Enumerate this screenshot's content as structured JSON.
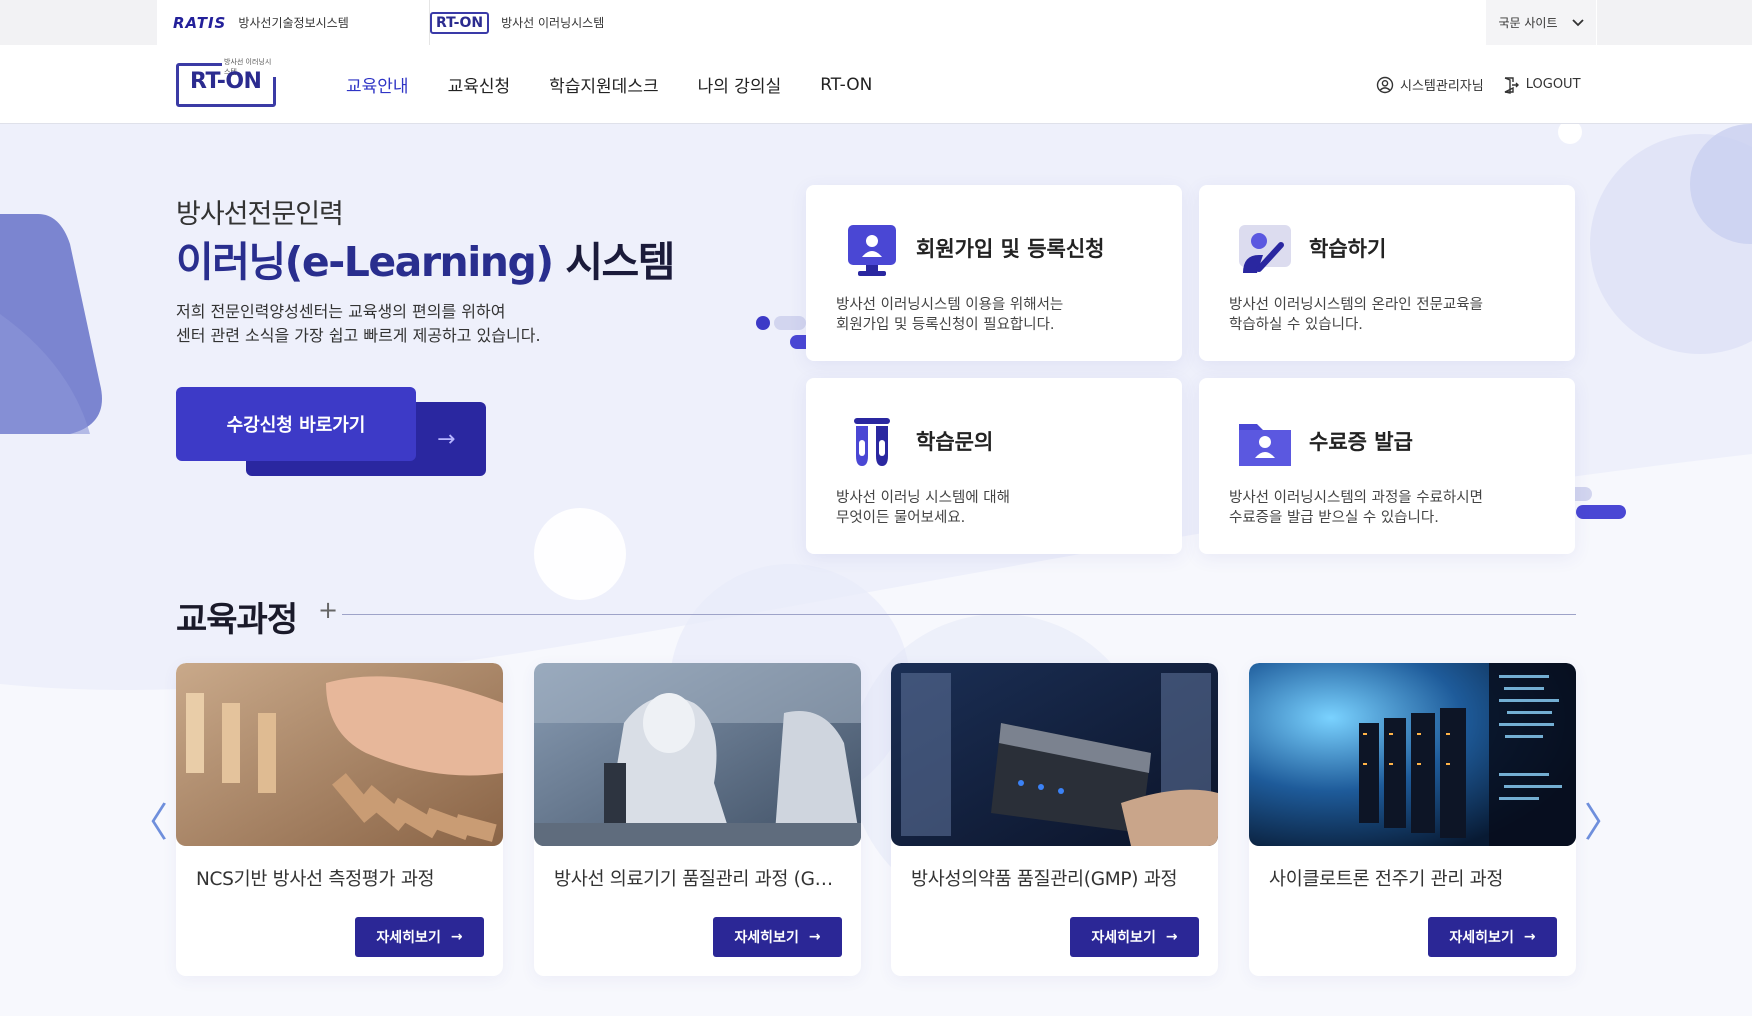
{
  "topbar": {
    "site1_logo": "RATIS",
    "site1_label": "방사선기술정보시스템",
    "site2_logo": "RT-ON",
    "site2_label": "방사선 이러닝시스템",
    "lang_label": "국문 사이트"
  },
  "header": {
    "brand_text": "RT-ON",
    "brand_sub": "방사선 이러닝시스템",
    "nav": [
      "교육안내",
      "교육신청",
      "학습지원데스크",
      "나의 강의실",
      "RT-ON"
    ],
    "user_label": "시스템관리자님",
    "logout_label": "LOGOUT"
  },
  "hero": {
    "title_line1": "방사선전문인력",
    "title_line2_accent": "이러닝(e-Learning)",
    "title_line2_rest": " 시스템",
    "desc_line1": "저희 전문인력양성센터는 교육생의 편의를 위하여",
    "desc_line2": "센터 관련 소식을 가장 쉽고 빠르게 제공하고 있습니다.",
    "cta_label": "수강신청 바로가기",
    "cta_arrow": "→"
  },
  "features": [
    {
      "title": "회원가입 및 등록신청",
      "desc1": "방사선 이러닝시스템 이용을 위해서는",
      "desc2": "회원가입 및 등록신청이 필요합니다.",
      "icon": "monitor-user-icon"
    },
    {
      "title": "학습하기",
      "desc1": "방사선 이러닝시스템의 온라인 전문교육을",
      "desc2": "학습하실 수 있습니다.",
      "icon": "learning-user-icon"
    },
    {
      "title": "학습문의",
      "desc1": "방사선 이러닝 시스템에 대해",
      "desc2": "무엇이든 물어보세요.",
      "icon": "test-tube-icon"
    },
    {
      "title": "수료증 발급",
      "desc1": "방사선 이러닝시스템의 과정을 수료하시면",
      "desc2": "수료증을 발급 받으실 수 있습니다.",
      "icon": "folder-user-icon"
    }
  ],
  "courses": {
    "section_title": "교육과정",
    "section_plus": "+",
    "items": [
      {
        "name": "NCS기반 방사선 측정평가 과정",
        "more": "자세히보기",
        "arrow": "→"
      },
      {
        "name": "방사선 의료기기 품질관리 과정 (GMP)",
        "more": "자세히보기",
        "arrow": "→"
      },
      {
        "name": "방사성의약품 품질관리(GMP) 과정",
        "more": "자세히보기",
        "arrow": "→"
      },
      {
        "name": "사이클로트론 전주기 관리 과정",
        "more": "자세히보기",
        "arrow": "→"
      }
    ],
    "prev": "〈",
    "next": "〉"
  },
  "colors": {
    "primary": "#3d3ac7",
    "primary_dark": "#2b2796",
    "nav_active": "#2f34c5",
    "hero_bg": "#eef0fb"
  }
}
